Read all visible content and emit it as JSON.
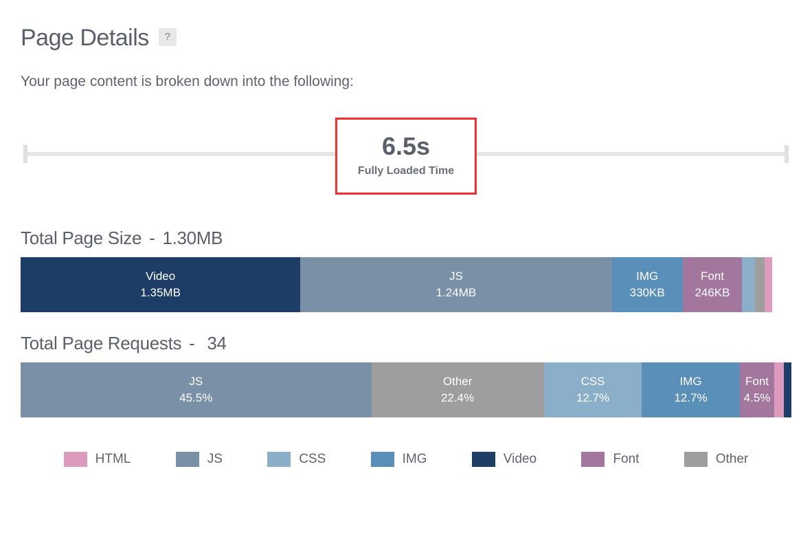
{
  "header": {
    "title": "Page Details",
    "help_glyph": "?",
    "subtitle": "Your page content is broken down into the following:"
  },
  "loaded": {
    "value": "6.5s",
    "label": "Fully Loaded Time"
  },
  "size_section": {
    "title_prefix": "Total Page Size",
    "total": "1.30MB"
  },
  "requests_section": {
    "title_prefix": "Total Page Requests",
    "total": "34"
  },
  "legend": {
    "html": "HTML",
    "js": "JS",
    "css": "CSS",
    "img": "IMG",
    "video": "Video",
    "font": "Font",
    "other": "Other"
  },
  "colors": {
    "html": "#dd9bbe",
    "js": "#7a90a6",
    "css": "#8bafc8",
    "img": "#5a8fba",
    "video": "#1e3d66",
    "font": "#a3769e",
    "other": "#9e9e9e"
  },
  "chart_data": [
    {
      "type": "bar",
      "title": "Total Page Size - 1.30MB",
      "stacked": true,
      "series": [
        {
          "name": "Video",
          "value_label": "1.35MB",
          "share_pct": 36.3,
          "color_key": "video"
        },
        {
          "name": "JS",
          "value_label": "1.24MB",
          "share_pct": 40.4,
          "color_key": "js"
        },
        {
          "name": "IMG",
          "value_label": "330KB",
          "share_pct": 9.2,
          "color_key": "img"
        },
        {
          "name": "Font",
          "value_label": "246KB",
          "share_pct": 7.7,
          "color_key": "font"
        },
        {
          "name": "CSS",
          "value_label": "",
          "share_pct": 1.7,
          "color_key": "css"
        },
        {
          "name": "Other",
          "value_label": "",
          "share_pct": 1.2,
          "color_key": "other"
        },
        {
          "name": "HTML",
          "value_label": "",
          "share_pct": 1.0,
          "color_key": "html"
        }
      ]
    },
    {
      "type": "bar",
      "title": "Total Page Requests - 34",
      "stacked": true,
      "series": [
        {
          "name": "JS",
          "value_label": "45.5%",
          "share_pct": 45.5,
          "color_key": "js"
        },
        {
          "name": "Other",
          "value_label": "22.4%",
          "share_pct": 22.4,
          "color_key": "other"
        },
        {
          "name": "CSS",
          "value_label": "12.7%",
          "share_pct": 12.7,
          "color_key": "css"
        },
        {
          "name": "IMG",
          "value_label": "12.7%",
          "share_pct": 12.7,
          "color_key": "img"
        },
        {
          "name": "Font",
          "value_label": "4.5%",
          "share_pct": 4.5,
          "color_key": "font"
        },
        {
          "name": "HTML",
          "value_label": "",
          "share_pct": 1.2,
          "color_key": "html"
        },
        {
          "name": "Video",
          "value_label": "",
          "share_pct": 1.0,
          "color_key": "video"
        }
      ]
    }
  ]
}
